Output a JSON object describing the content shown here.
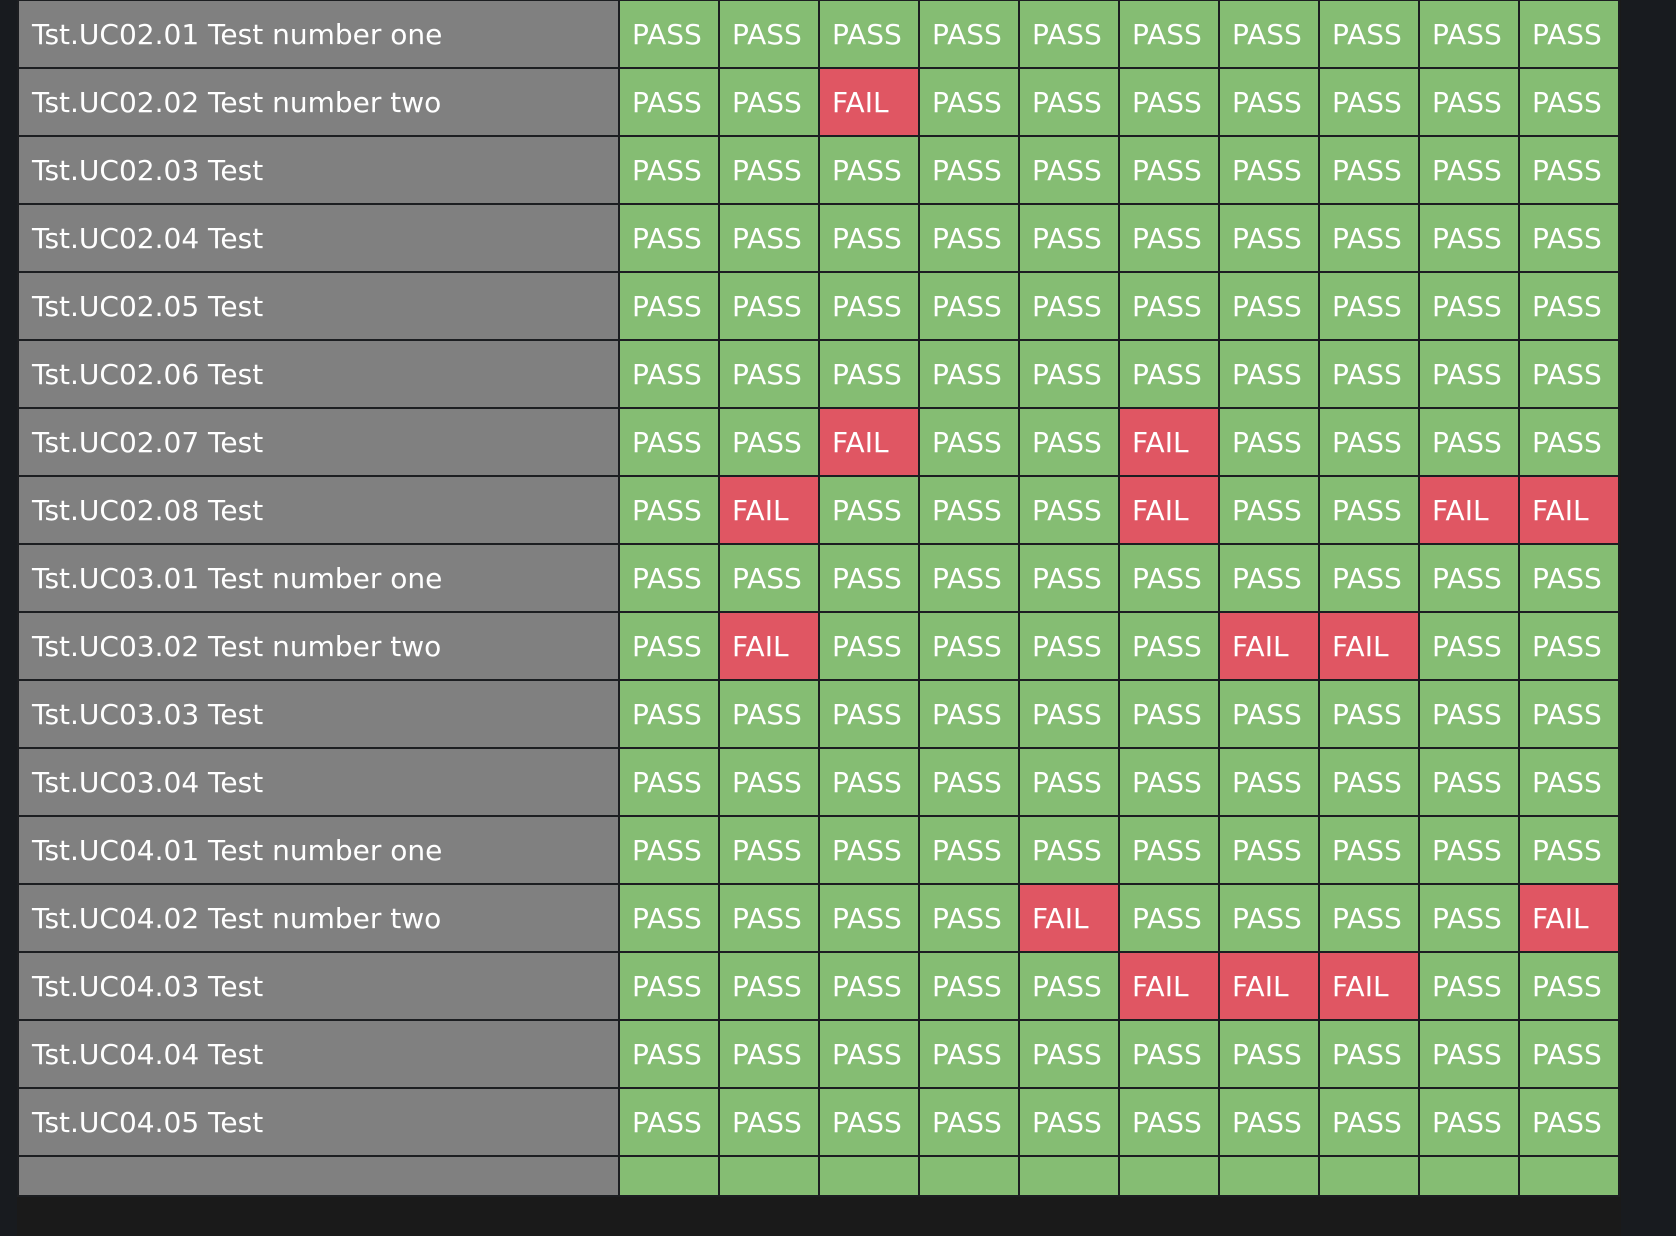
{
  "colors": {
    "pass": "#85bd73",
    "fail": "#e05663",
    "name_cell": "#808080",
    "background": "#181b1f"
  },
  "rows": [
    {
      "name": "Tst.UC02.01 Test number one",
      "results": [
        "PASS",
        "PASS",
        "PASS",
        "PASS",
        "PASS",
        "PASS",
        "PASS",
        "PASS",
        "PASS",
        "PASS"
      ]
    },
    {
      "name": "Tst.UC02.02 Test number two",
      "results": [
        "PASS",
        "PASS",
        "FAIL",
        "PASS",
        "PASS",
        "PASS",
        "PASS",
        "PASS",
        "PASS",
        "PASS"
      ]
    },
    {
      "name": "Tst.UC02.03 Test",
      "results": [
        "PASS",
        "PASS",
        "PASS",
        "PASS",
        "PASS",
        "PASS",
        "PASS",
        "PASS",
        "PASS",
        "PASS"
      ]
    },
    {
      "name": "Tst.UC02.04 Test",
      "results": [
        "PASS",
        "PASS",
        "PASS",
        "PASS",
        "PASS",
        "PASS",
        "PASS",
        "PASS",
        "PASS",
        "PASS"
      ]
    },
    {
      "name": "Tst.UC02.05 Test",
      "results": [
        "PASS",
        "PASS",
        "PASS",
        "PASS",
        "PASS",
        "PASS",
        "PASS",
        "PASS",
        "PASS",
        "PASS"
      ]
    },
    {
      "name": "Tst.UC02.06 Test",
      "results": [
        "PASS",
        "PASS",
        "PASS",
        "PASS",
        "PASS",
        "PASS",
        "PASS",
        "PASS",
        "PASS",
        "PASS"
      ]
    },
    {
      "name": "Tst.UC02.07 Test",
      "results": [
        "PASS",
        "PASS",
        "FAIL",
        "PASS",
        "PASS",
        "FAIL",
        "PASS",
        "PASS",
        "PASS",
        "PASS"
      ]
    },
    {
      "name": "Tst.UC02.08 Test",
      "results": [
        "PASS",
        "FAIL",
        "PASS",
        "PASS",
        "PASS",
        "FAIL",
        "PASS",
        "PASS",
        "FAIL",
        "FAIL"
      ]
    },
    {
      "name": "Tst.UC03.01 Test number one",
      "results": [
        "PASS",
        "PASS",
        "PASS",
        "PASS",
        "PASS",
        "PASS",
        "PASS",
        "PASS",
        "PASS",
        "PASS"
      ]
    },
    {
      "name": "Tst.UC03.02 Test number two",
      "results": [
        "PASS",
        "FAIL",
        "PASS",
        "PASS",
        "PASS",
        "PASS",
        "FAIL",
        "FAIL",
        "PASS",
        "PASS"
      ]
    },
    {
      "name": "Tst.UC03.03 Test",
      "results": [
        "PASS",
        "PASS",
        "PASS",
        "PASS",
        "PASS",
        "PASS",
        "PASS",
        "PASS",
        "PASS",
        "PASS"
      ]
    },
    {
      "name": "Tst.UC03.04 Test",
      "results": [
        "PASS",
        "PASS",
        "PASS",
        "PASS",
        "PASS",
        "PASS",
        "PASS",
        "PASS",
        "PASS",
        "PASS"
      ]
    },
    {
      "name": "Tst.UC04.01 Test number one",
      "results": [
        "PASS",
        "PASS",
        "PASS",
        "PASS",
        "PASS",
        "PASS",
        "PASS",
        "PASS",
        "PASS",
        "PASS"
      ]
    },
    {
      "name": "Tst.UC04.02 Test number two",
      "results": [
        "PASS",
        "PASS",
        "PASS",
        "PASS",
        "FAIL",
        "PASS",
        "PASS",
        "PASS",
        "PASS",
        "FAIL"
      ]
    },
    {
      "name": "Tst.UC04.03 Test",
      "results": [
        "PASS",
        "PASS",
        "PASS",
        "PASS",
        "PASS",
        "FAIL",
        "FAIL",
        "FAIL",
        "PASS",
        "PASS"
      ]
    },
    {
      "name": "Tst.UC04.04 Test",
      "results": [
        "PASS",
        "PASS",
        "PASS",
        "PASS",
        "PASS",
        "PASS",
        "PASS",
        "PASS",
        "PASS",
        "PASS"
      ]
    },
    {
      "name": "Tst.UC04.05 Test",
      "results": [
        "PASS",
        "PASS",
        "PASS",
        "PASS",
        "PASS",
        "PASS",
        "PASS",
        "PASS",
        "PASS",
        "PASS"
      ]
    }
  ]
}
